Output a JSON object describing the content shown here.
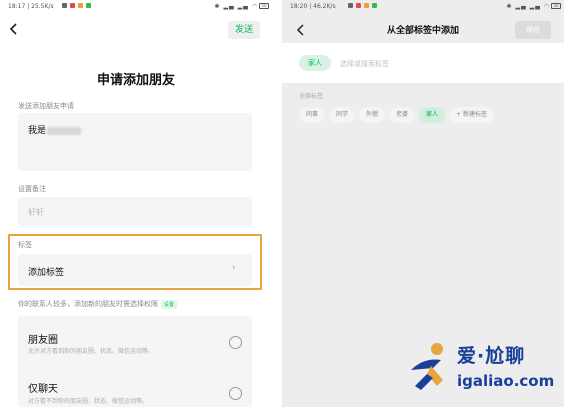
{
  "left_screen": {
    "status": {
      "time": "18:17 | 25.5K/s",
      "icons": [
        "red",
        "green",
        "red",
        "green"
      ],
      "system": "✱ ▂▄ ▂▄ ◠",
      "battery": "50"
    },
    "send_label": "发送",
    "title": "申请添加朋友",
    "message_label": "发送添加朋友申请",
    "message_value": "我是",
    "remark_label": "设置备注",
    "remark_value": "轩轩",
    "tag_label": "标签",
    "tag_row": "添加标签",
    "tag_arrow": "›",
    "privacy_label": "你的联系人较多，添加新的朋友时需选择权限",
    "privacy_badge": "设置",
    "options": [
      {
        "title": "朋友圈",
        "desc": "允许对方看到你的朋友圈、状态、微信运动等。"
      },
      {
        "title": "仅聊天",
        "desc": "对方看不到你的朋友圈、状态、微信运动等。"
      }
    ]
  },
  "right_screen": {
    "status": {
      "time": "18:20 | 46.2K/s",
      "icons": [
        "red",
        "green",
        "red",
        "green"
      ],
      "system": "✱ ▂▄ ▂▄ ◠",
      "battery": "50"
    },
    "title": "从全部标签中添加",
    "save_label": "保存",
    "selected_chip": "家人",
    "input_placeholder": "选择或搜索标签",
    "all_tags_label": "全部标签",
    "tags": [
      {
        "label": "同事",
        "selected": false
      },
      {
        "label": "同学",
        "selected": false
      },
      {
        "label": "外貌",
        "selected": false
      },
      {
        "label": "老婆",
        "selected": false
      },
      {
        "label": "家人",
        "selected": true
      },
      {
        "label": "+ 新建标签",
        "selected": false
      }
    ]
  },
  "watermark": {
    "cn": "爱·尬聊",
    "en": "igaliao.com"
  },
  "colors": {
    "accent": "#07c160",
    "highlight_border": "#e8a43f",
    "watermark": "#1a3f9b"
  }
}
